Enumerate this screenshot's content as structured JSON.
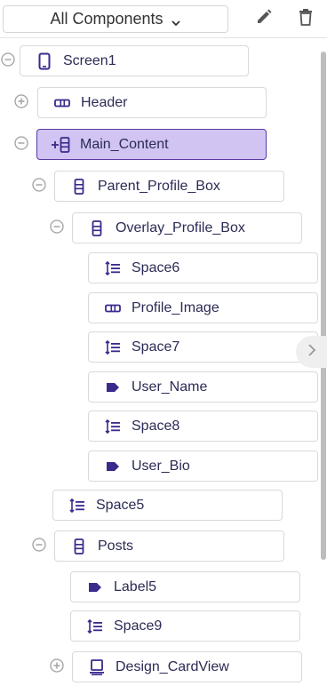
{
  "toolbar": {
    "filter_label": "All Components",
    "edit_icon": "pencil-icon",
    "delete_icon": "trash-icon"
  },
  "colors": {
    "accent": "#3a2a8c",
    "selected_bg": "#d1c4f2",
    "selected_border": "#5b3aa6",
    "toggle_grey": "#9a9a9a"
  },
  "tree": [
    {
      "label": "Screen1",
      "icon": "phone-icon",
      "toggle": "minus"
    },
    {
      "label": "Header",
      "icon": "horizontal-arrangement-icon",
      "toggle": "plus"
    },
    {
      "label": "Main_Content",
      "icon": "add-vertical-arrangement-icon",
      "toggle": "minus",
      "selected": true
    },
    {
      "label": "Parent_Profile_Box",
      "icon": "vertical-arrangement-icon",
      "toggle": "minus"
    },
    {
      "label": "Overlay_Profile_Box",
      "icon": "vertical-arrangement-icon",
      "toggle": "minus"
    },
    {
      "label": "Space6",
      "icon": "space-icon"
    },
    {
      "label": "Profile_Image",
      "icon": "horizontal-arrangement-icon"
    },
    {
      "label": "Space7",
      "icon": "space-icon"
    },
    {
      "label": "User_Name",
      "icon": "label-icon"
    },
    {
      "label": "Space8",
      "icon": "space-icon"
    },
    {
      "label": "User_Bio",
      "icon": "label-icon"
    },
    {
      "label": "Space5",
      "icon": "space-icon"
    },
    {
      "label": "Posts",
      "icon": "vertical-arrangement-icon",
      "toggle": "minus"
    },
    {
      "label": "Label5",
      "icon": "label-icon"
    },
    {
      "label": "Space9",
      "icon": "space-icon"
    },
    {
      "label": "Design_CardView",
      "icon": "card-view-icon",
      "toggle": "plus"
    }
  ]
}
